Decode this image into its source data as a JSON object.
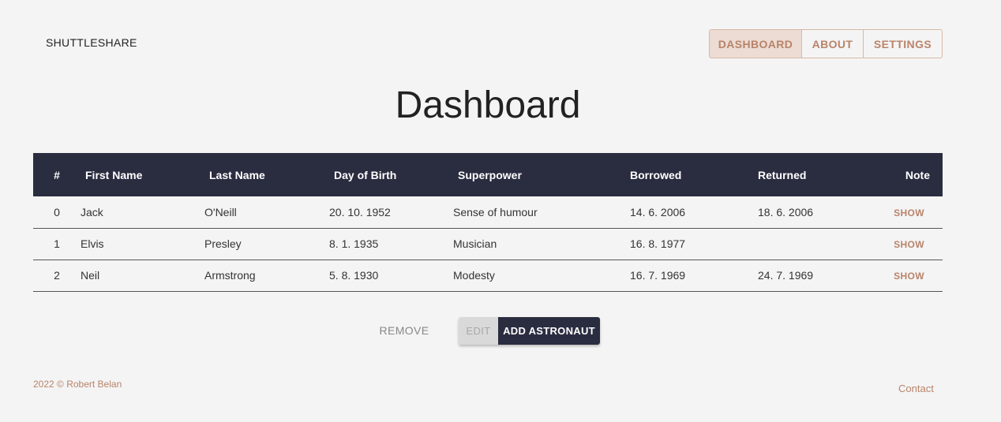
{
  "header": {
    "brand": "SHUTTLESHARE",
    "nav": [
      {
        "label": "DASHBOARD",
        "active": true
      },
      {
        "label": "ABOUT",
        "active": false
      },
      {
        "label": "SETTINGS",
        "active": false
      }
    ]
  },
  "page_title": "Dashboard",
  "table": {
    "columns": [
      "#",
      "First Name",
      "Last Name",
      "Day of Birth",
      "Superpower",
      "Borrowed",
      "Returned",
      "Note"
    ],
    "rows": [
      {
        "index": "0",
        "first_name": "Jack",
        "last_name": "O'Neill",
        "birth": "20. 10. 1952",
        "superpower": "Sense of humour",
        "borrowed": "14. 6. 2006",
        "returned": "18. 6. 2006",
        "note": "SHOW"
      },
      {
        "index": "1",
        "first_name": "Elvis",
        "last_name": "Presley",
        "birth": "8. 1. 1935",
        "superpower": "Musician",
        "borrowed": "16. 8. 1977",
        "returned": "",
        "note": "SHOW"
      },
      {
        "index": "2",
        "first_name": "Neil",
        "last_name": "Armstrong",
        "birth": "5. 8. 1930",
        "superpower": "Modesty",
        "borrowed": "16. 7. 1969",
        "returned": "24. 7. 1969",
        "note": "SHOW"
      }
    ]
  },
  "actions": {
    "remove": "REMOVE",
    "edit": "EDIT",
    "add": "ADD ASTRONAUT"
  },
  "footer": {
    "copyright": "2022 © Robert Belan",
    "contact": "Contact"
  },
  "colors": {
    "accent": "#b9836a",
    "header_bg": "#2a2c40",
    "page_bg": "#f4f4f4",
    "nav_active_bg": "#ecdcd3"
  }
}
